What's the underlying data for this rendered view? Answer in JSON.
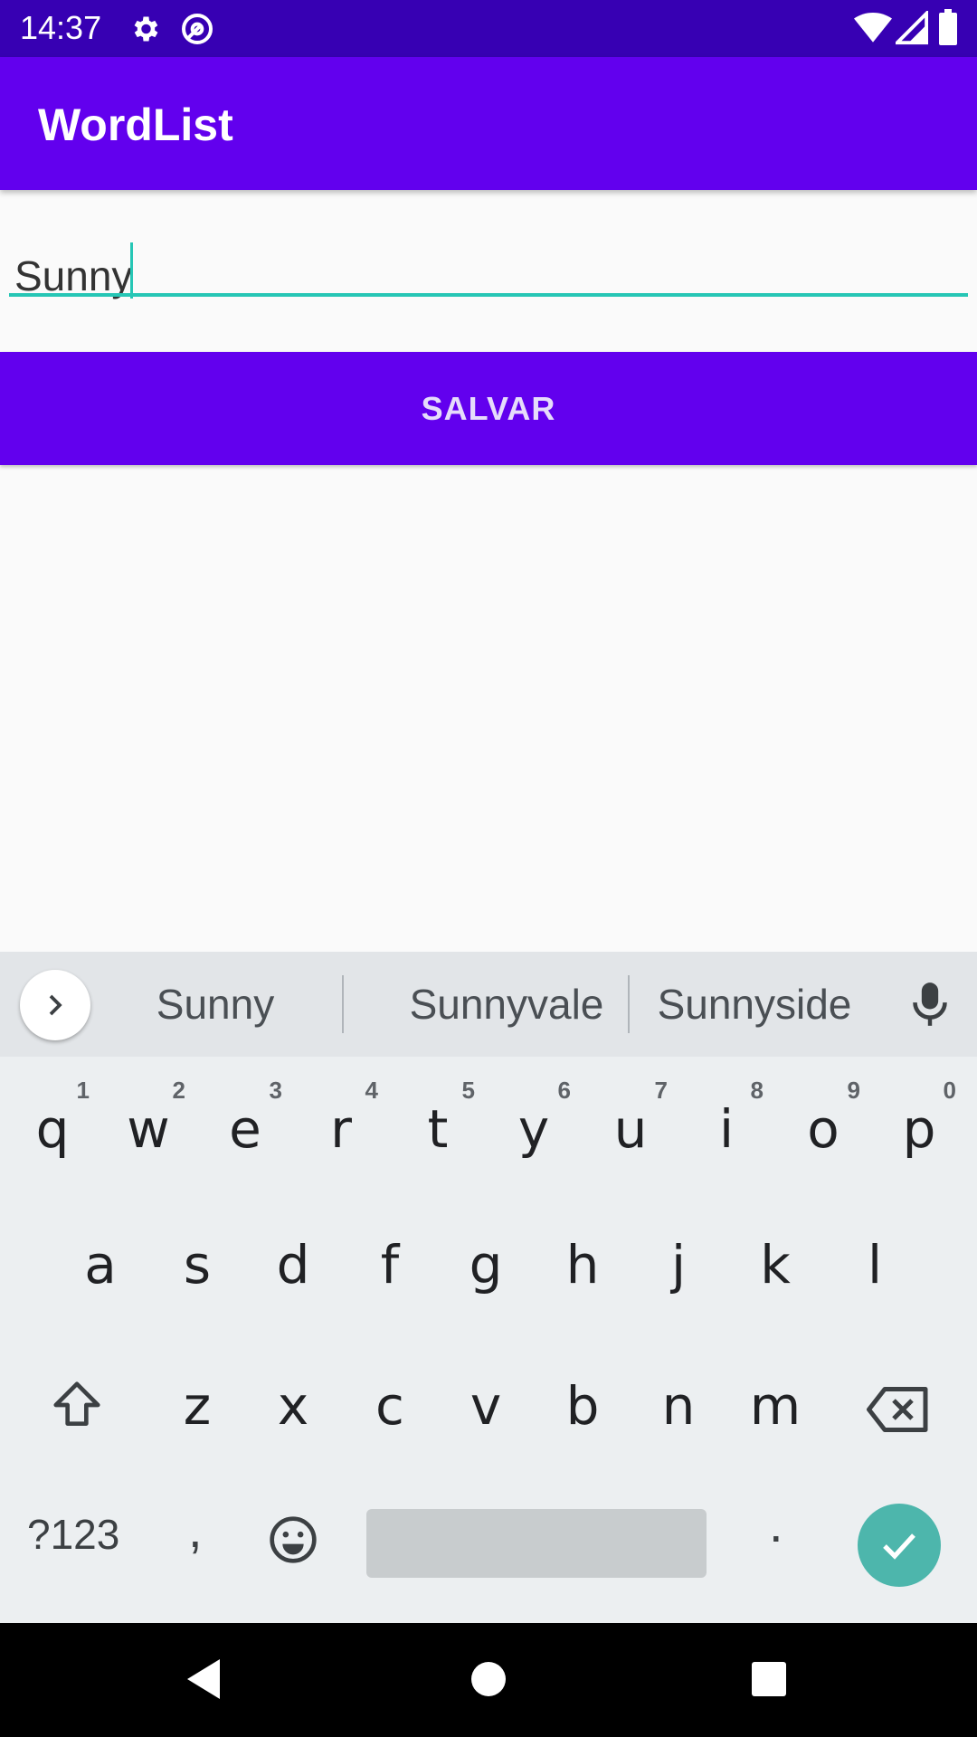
{
  "status_bar": {
    "time": "14:37",
    "icons": [
      "settings-icon",
      "data-saver-icon",
      "wifi-icon",
      "signal-icon",
      "battery-icon"
    ]
  },
  "app_bar": {
    "title": "WordList",
    "color": "#6200ee"
  },
  "editor": {
    "value": "Sunny",
    "accent_color": "#26c6b5"
  },
  "save_button": {
    "label": "SALVAR"
  },
  "keyboard": {
    "suggestions": [
      "Sunny",
      "Sunnyvale",
      "Sunnyside"
    ],
    "row1": [
      {
        "key": "q",
        "hint": "1"
      },
      {
        "key": "w",
        "hint": "2"
      },
      {
        "key": "e",
        "hint": "3"
      },
      {
        "key": "r",
        "hint": "4"
      },
      {
        "key": "t",
        "hint": "5"
      },
      {
        "key": "y",
        "hint": "6"
      },
      {
        "key": "u",
        "hint": "7"
      },
      {
        "key": "i",
        "hint": "8"
      },
      {
        "key": "o",
        "hint": "9"
      },
      {
        "key": "p",
        "hint": "0"
      }
    ],
    "row2": [
      "a",
      "s",
      "d",
      "f",
      "g",
      "h",
      "j",
      "k",
      "l"
    ],
    "row3": [
      "z",
      "x",
      "c",
      "v",
      "b",
      "n",
      "m"
    ],
    "symbols_label": "?123",
    "comma_label": ",",
    "period_label": ".",
    "enter_color": "#4db6ac"
  },
  "nav_bar": {
    "icons": [
      "back-icon",
      "home-icon",
      "recents-icon"
    ]
  }
}
